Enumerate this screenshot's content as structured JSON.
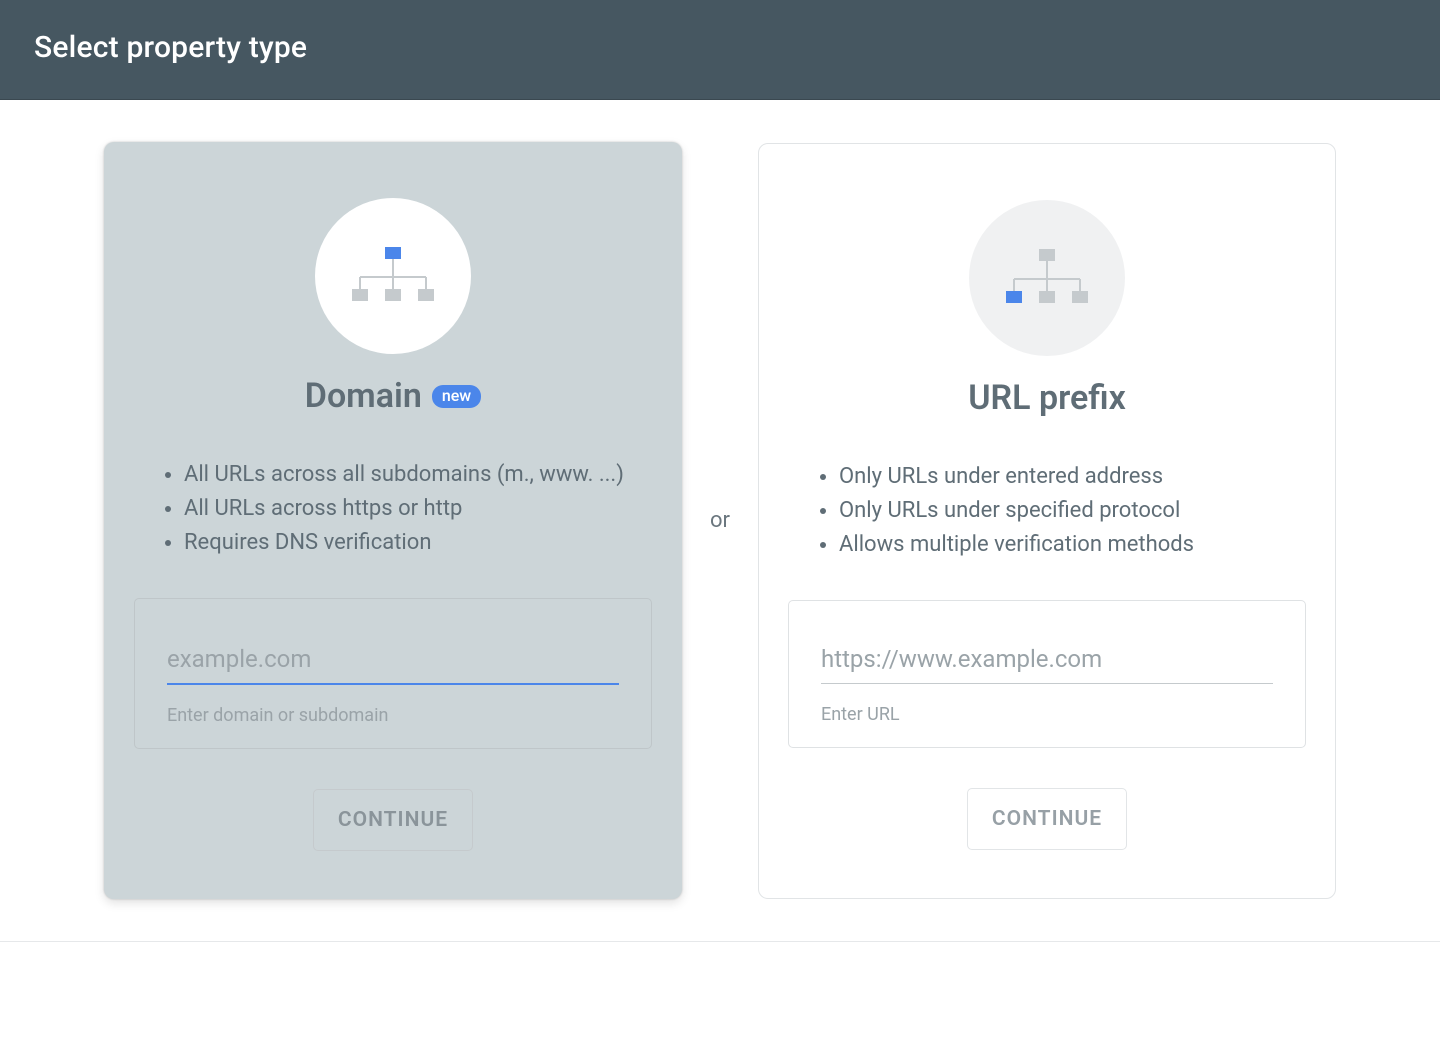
{
  "header": {
    "title": "Select property type"
  },
  "separator": "or",
  "domain_card": {
    "title": "Domain",
    "badge": "new",
    "features": [
      "All URLs across all subdomains (m., www. ...)",
      "All URLs across https or http",
      "Requires DNS verification"
    ],
    "input_placeholder": "example.com",
    "input_helper": "Enter domain or subdomain",
    "button": "CONTINUE"
  },
  "url_card": {
    "title": "URL prefix",
    "features": [
      "Only URLs under entered address",
      "Only URLs under specified protocol",
      "Allows multiple verification methods"
    ],
    "input_placeholder": "https://www.example.com",
    "input_helper": "Enter URL",
    "button": "CONTINUE"
  },
  "colors": {
    "header_bg": "#465761",
    "accent": "#4b86ea",
    "card_left_bg": "#ccd5d8",
    "text_muted": "#5f6d76",
    "icon_gray": "#c5cacd"
  }
}
